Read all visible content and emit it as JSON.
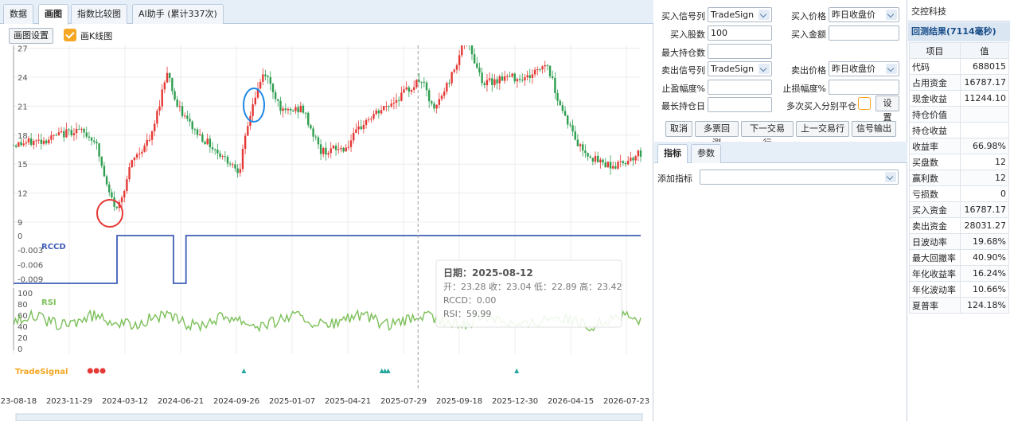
{
  "tabs": [
    {
      "label": "数据",
      "active": false
    },
    {
      "label": "画图",
      "active": true
    },
    {
      "label": "指数比较图",
      "active": false
    },
    {
      "label": "AI助手 (累计337次)",
      "active": false
    }
  ],
  "toolbar": {
    "settings_label": "画图设置",
    "kline_label": "画K线图",
    "kline_checked": true
  },
  "chart_data": {
    "type": "candlestick",
    "price_y_ticks": [
      "27",
      "24",
      "21",
      "18",
      "15",
      "12",
      "9"
    ],
    "x_labels": [
      "2023-08-18",
      "2023-11-29",
      "2024-03-12",
      "2024-06-21",
      "2024-09-26",
      "2025-01-07",
      "2025-04-21",
      "2025-07-29",
      "2025-09-18",
      "2025-12-30",
      "2026-04-15",
      "2026-07-23"
    ],
    "price_path": [
      [
        0,
        17
      ],
      [
        0.05,
        17.5
      ],
      [
        0.1,
        18.6
      ],
      [
        0.13,
        17.5
      ],
      [
        0.15,
        12.3
      ],
      [
        0.165,
        10.2
      ],
      [
        0.19,
        15.4
      ],
      [
        0.22,
        17.8
      ],
      [
        0.245,
        24.8
      ],
      [
        0.26,
        21
      ],
      [
        0.29,
        18.4
      ],
      [
        0.33,
        16
      ],
      [
        0.36,
        14.4
      ],
      [
        0.38,
        21
      ],
      [
        0.4,
        24.6
      ],
      [
        0.43,
        20.3
      ],
      [
        0.46,
        20.8
      ],
      [
        0.49,
        16.3
      ],
      [
        0.53,
        16.7
      ],
      [
        0.56,
        19.4
      ],
      [
        0.6,
        21.2
      ],
      [
        0.65,
        23.8
      ],
      [
        0.67,
        20.4
      ],
      [
        0.7,
        24.4
      ],
      [
        0.72,
        28.2
      ],
      [
        0.75,
        23.3
      ],
      [
        0.78,
        24
      ],
      [
        0.82,
        24
      ],
      [
        0.85,
        25.5
      ],
      [
        0.87,
        21.4
      ],
      [
        0.9,
        17
      ],
      [
        0.93,
        15.3
      ],
      [
        0.96,
        14.8
      ],
      [
        1,
        16.2
      ]
    ],
    "rccd": {
      "name": "RCCD",
      "y_ticks": [
        "0",
        "-0.003",
        "-0.006",
        "-0.009"
      ],
      "low_periods": [
        [
          0,
          0.165
        ],
        [
          0.255,
          0.275
        ]
      ],
      "low_value": -0.0099,
      "high_value": 0
    },
    "rsi": {
      "name": "RSI",
      "y_ticks": [
        "100",
        "80",
        "60",
        "40",
        "20",
        "0"
      ],
      "mean": 50
    },
    "signals": {
      "name": "TradeSignal",
      "sell_markers": [
        0.14,
        0.15,
        0.16
      ],
      "buy_markers": [
        0.385,
        0.605,
        0.61,
        0.615,
        0.82
      ]
    },
    "tooltip": {
      "date": "日期：2025-08-12",
      "ohlc": "开：23.28 收：23.04 低：22.89 高：23.42",
      "rccd": "RCCD：0.00",
      "rsi": "RSI：59.99"
    },
    "crosshair_x": 0.645
  },
  "form": {
    "buy_signal_label": "买入信号列",
    "buy_signal_value": "TradeSign",
    "buy_price_label": "买入价格",
    "buy_price_value": "昨日收盘价",
    "buy_shares_label": "买入股数",
    "buy_shares_value": "100",
    "buy_amount_label": "买入金额",
    "max_pos_label": "最大持仓数",
    "sell_signal_label": "卖出信号列",
    "sell_signal_value": "TradeSign",
    "sell_price_label": "卖出价格",
    "sell_price_value": "昨日收盘价",
    "take_profit_label": "止盈幅度%",
    "stop_loss_label": "止损幅度%",
    "max_hold_label": "最长持仓日",
    "multi_buy_label": "多次买入分别平仓",
    "settings_button": "设置",
    "buttons": [
      "取消",
      "多票回测",
      "下一交易行",
      "上一交易行",
      "信号输出"
    ],
    "subtabs": [
      "指标",
      "参数"
    ],
    "add_indicator_label": "添加指标"
  },
  "result": {
    "company": "交控科技",
    "header": "回测结果(7114毫秒)",
    "col_item": "项目",
    "col_value": "值",
    "rows": [
      [
        "代码",
        "688015"
      ],
      [
        "占用资金",
        "16787.17"
      ],
      [
        "现金收益",
        "11244.10"
      ],
      [
        "持仓价值",
        ""
      ],
      [
        "持仓收益",
        ""
      ],
      [
        "收益率",
        "66.98%"
      ],
      [
        "买盘数",
        "12"
      ],
      [
        "赢利数",
        "12"
      ],
      [
        "亏损数",
        "0"
      ],
      [
        "买入资金",
        "16787.17"
      ],
      [
        "卖出资金",
        "28031.27"
      ],
      [
        "日波动率",
        "19.68%"
      ],
      [
        "最大回撤率",
        "40.90%"
      ],
      [
        "年化收益率",
        "16.24%"
      ],
      [
        "年化波动率",
        "10.66%"
      ],
      [
        "夏普率",
        "124.18%"
      ]
    ]
  }
}
